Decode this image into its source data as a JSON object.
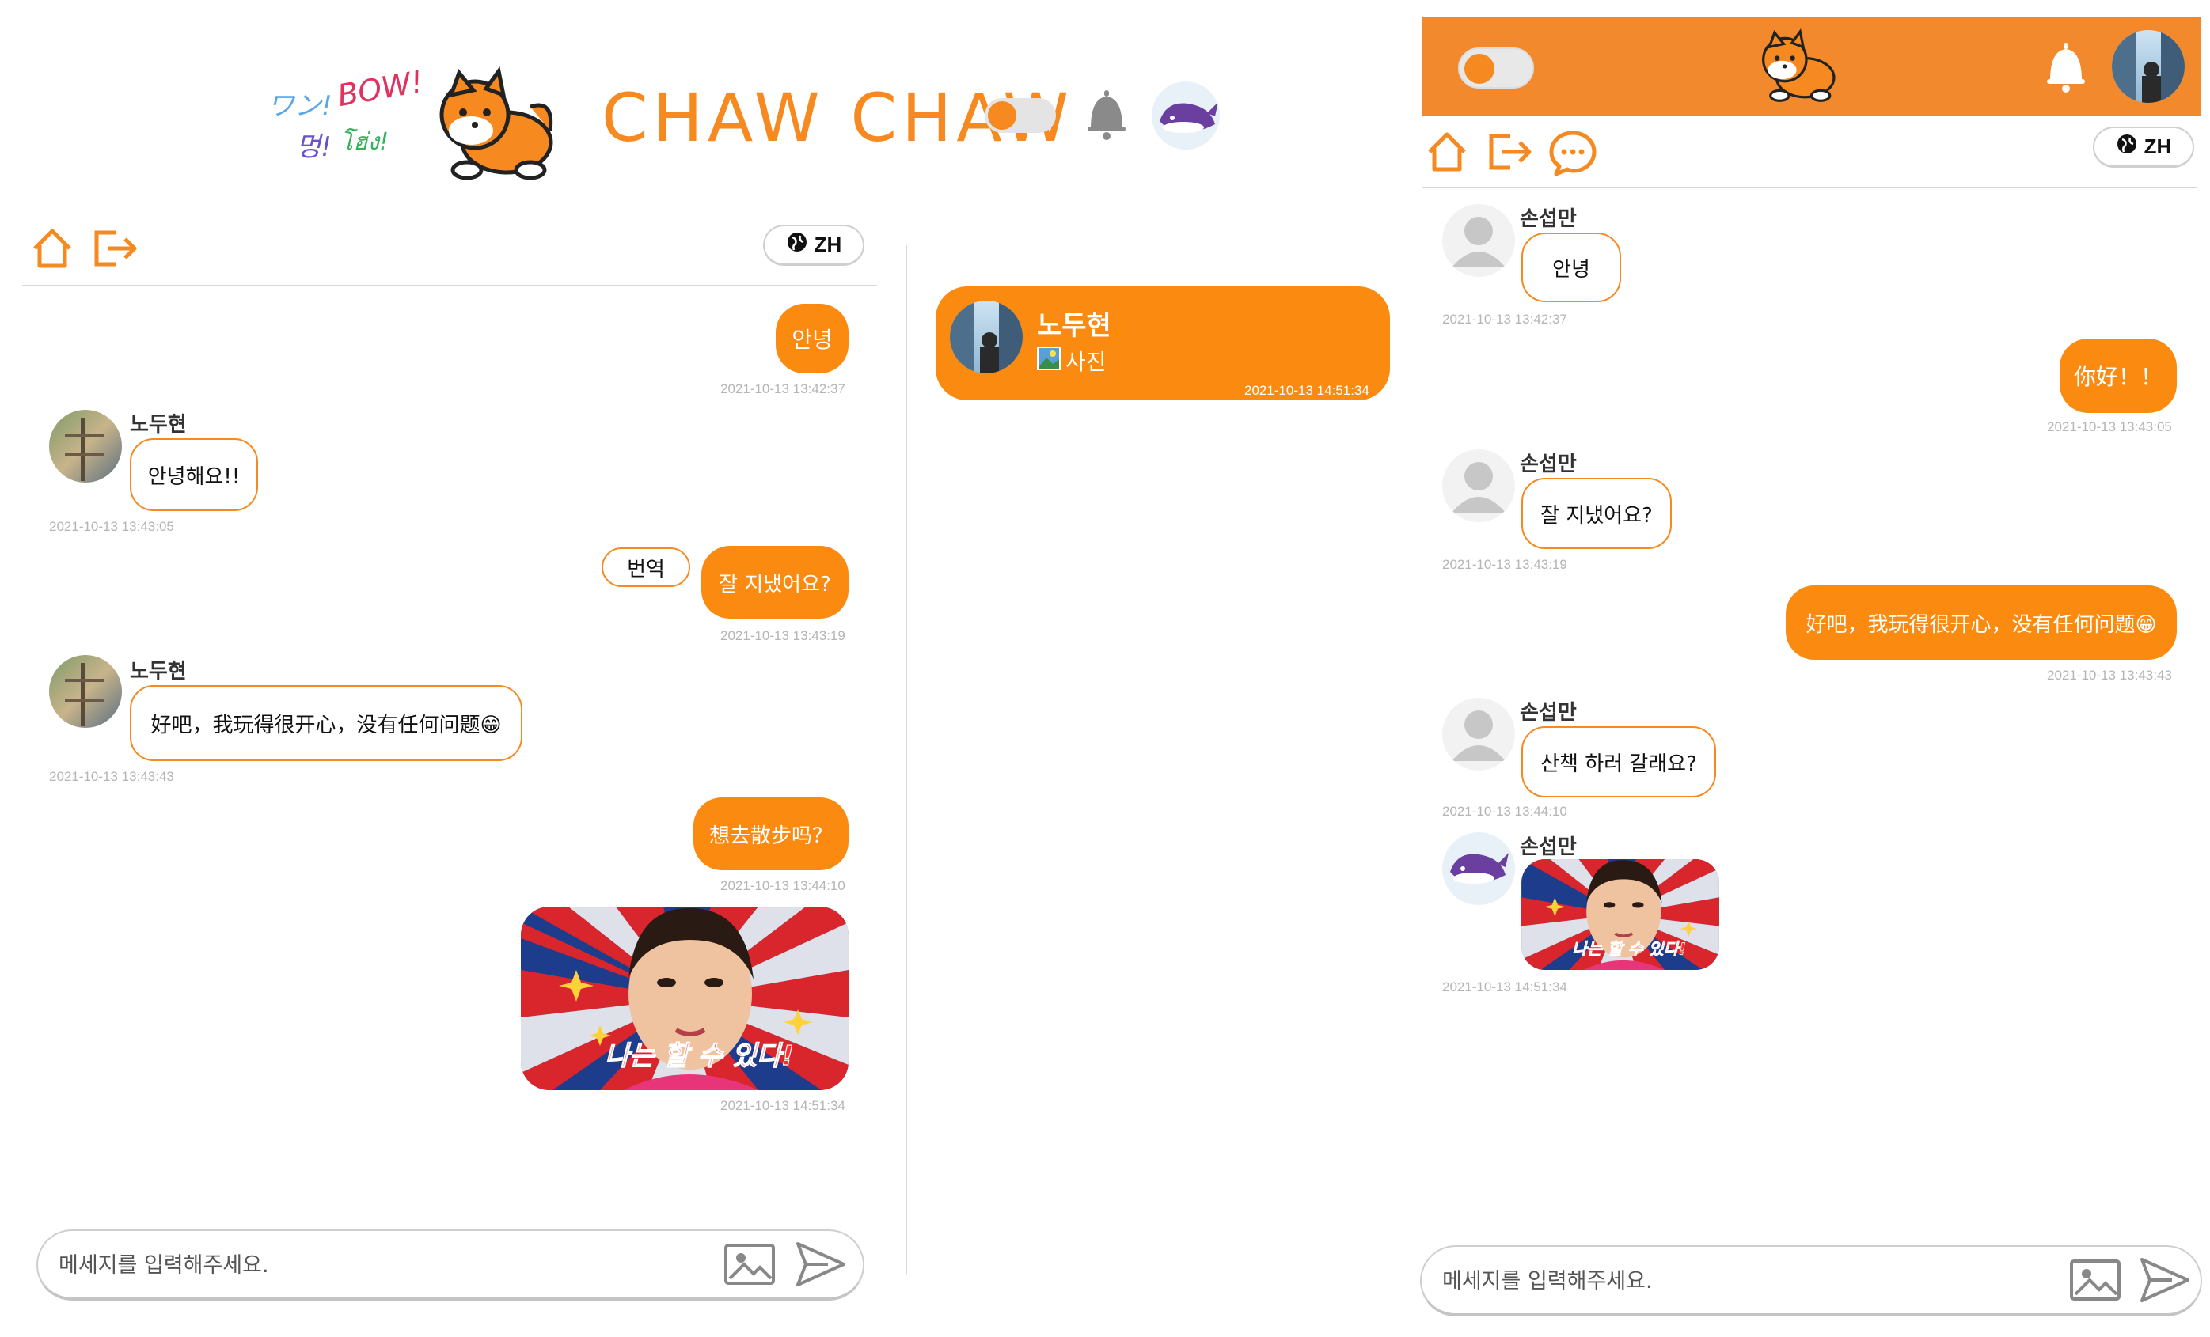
{
  "desktop": {
    "greeting_words": [
      "ワン!",
      "BOW!",
      "멍!",
      "โฮ่ง!"
    ],
    "brand_title": "CHAW CHAW",
    "language_label": "ZH",
    "messages": [
      {
        "side": "me",
        "text": "안녕",
        "time": "2021-10-13 13:42:37"
      },
      {
        "side": "other",
        "sender": "노두현",
        "text": "안녕해요!!",
        "time": "2021-10-13 13:43:05"
      },
      {
        "side": "me",
        "text": "잘 지냈어요?",
        "time": "2021-10-13 13:43:19",
        "translate_label": "번역"
      },
      {
        "side": "other",
        "sender": "노두현",
        "text": "好吧，我玩得很开心，没有任何问题😁",
        "time": "2021-10-13 13:43:43"
      },
      {
        "side": "me",
        "text": "想去散步吗？",
        "time": "2021-10-13 13:44:10"
      },
      {
        "side": "me",
        "type": "image",
        "image_caption": "나는 할 수 있다!",
        "time": "2021-10-13 14:51:34"
      }
    ],
    "input_placeholder": "메세지를 입력해주세요."
  },
  "chat_list": {
    "items": [
      {
        "name": "노두현",
        "preview": "사진",
        "time": "2021-10-13 14:51:34"
      }
    ]
  },
  "mobile": {
    "language_label": "ZH",
    "messages": [
      {
        "side": "other",
        "sender": "손섭만",
        "text": "안녕",
        "time": "2021-10-13 13:42:37"
      },
      {
        "side": "me",
        "text": "你好！！",
        "time": "2021-10-13 13:43:05"
      },
      {
        "side": "other",
        "sender": "손섭만",
        "text": "잘 지냈어요?",
        "time": "2021-10-13 13:43:19"
      },
      {
        "side": "me",
        "text": "好吧，我玩得很开心，没有任何问题😁",
        "time": "2021-10-13 13:43:43"
      },
      {
        "side": "other",
        "sender": "손섭만",
        "text": "산책 하러 갈래요?",
        "time": "2021-10-13 13:44:10"
      },
      {
        "side": "other",
        "sender": "손섭만",
        "type": "image",
        "image_caption": "나는 할 수 있다!",
        "time": "2021-10-13 14:51:34"
      }
    ],
    "input_placeholder": "메세지를 입력해주세요."
  },
  "colors": {
    "accent": "#fb8a10",
    "header": "#f28a2d",
    "timestamp": "#b5b5b5"
  },
  "icons": [
    "home-icon",
    "logout-icon",
    "chat-icon",
    "globe-icon",
    "bell-icon",
    "image-upload-icon",
    "send-icon",
    "whale-avatar",
    "shiba-dog-logo"
  ]
}
